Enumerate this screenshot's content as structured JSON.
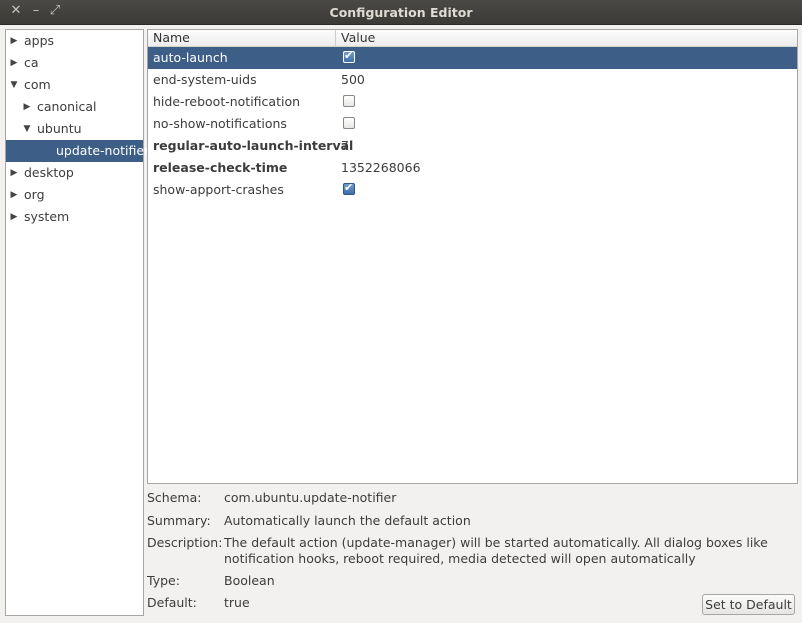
{
  "window": {
    "title": "Configuration Editor"
  },
  "tree": [
    {
      "label": "apps",
      "arrow": "▶",
      "depth": 0
    },
    {
      "label": "ca",
      "arrow": "▶",
      "depth": 0
    },
    {
      "label": "com",
      "arrow": "▼",
      "depth": 0
    },
    {
      "label": "canonical",
      "arrow": "▶",
      "depth": 1
    },
    {
      "label": "ubuntu",
      "arrow": "▼",
      "depth": 1
    },
    {
      "label": "update-notifier",
      "arrow": "",
      "depth": 2,
      "selected": true
    },
    {
      "label": "desktop",
      "arrow": "▶",
      "depth": 0
    },
    {
      "label": "org",
      "arrow": "▶",
      "depth": 0
    },
    {
      "label": "system",
      "arrow": "▶",
      "depth": 0
    }
  ],
  "table": {
    "col_name": "Name",
    "col_value": "Value",
    "rows": [
      {
        "key": "auto-launch",
        "type": "check",
        "checked": true,
        "selected": true
      },
      {
        "key": "end-system-uids",
        "type": "text",
        "value": "500"
      },
      {
        "key": "hide-reboot-notification",
        "type": "check",
        "checked": false
      },
      {
        "key": "no-show-notifications",
        "type": "check",
        "checked": false
      },
      {
        "key": "regular-auto-launch-interval",
        "type": "text",
        "value": "7",
        "bold": true
      },
      {
        "key": "release-check-time",
        "type": "text",
        "value": "1352268066",
        "bold": true
      },
      {
        "key": "show-apport-crashes",
        "type": "check",
        "checked": true
      }
    ]
  },
  "details": {
    "schema_label": "Schema:",
    "schema": "com.ubuntu.update-notifier",
    "summary_label": "Summary:",
    "summary": "Automatically launch the default action",
    "description_label": "Description:",
    "description": "The default action (update-manager) will be started automatically. All dialog boxes like notification hooks, reboot required, media detected will open automatically",
    "type_label": "Type:",
    "type": "Boolean",
    "default_label": "Default:",
    "default": "true"
  },
  "set_default_label": "Set to Default"
}
